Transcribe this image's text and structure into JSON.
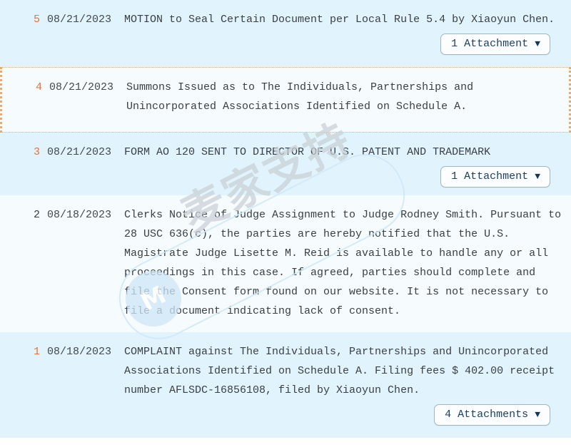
{
  "watermark": {
    "text": "麦家支持",
    "logo_glyph": "M"
  },
  "docket": {
    "entries": [
      {
        "number": "5",
        "number_color": "#e8713c",
        "date": "08/21/2023",
        "lines": [
          "MOTION to Seal Certain Document per Local Rule 5.4 by Xiaoyun Chen."
        ],
        "attachment_label": "1 Attachment",
        "caret": "▼"
      },
      {
        "number": "4",
        "number_color": "#e8713c",
        "date": "08/21/2023",
        "lines": [
          "Summons Issued as to The Individuals, Partnerships and",
          "Unincorporated Associations Identified on Schedule A."
        ],
        "attachment_label": "",
        "caret": ""
      },
      {
        "number": "3",
        "number_color": "#e8713c",
        "date": "08/21/2023",
        "lines": [
          "FORM AO 120 SENT TO DIRECTOR OF U.S. PATENT AND TRADEMARK"
        ],
        "attachment_label": "1 Attachment",
        "caret": "▼"
      },
      {
        "number": "2",
        "number_color": "#3b3b3b",
        "date": "08/18/2023",
        "lines": [
          "Clerks Notice of Judge Assignment to Judge Rodney Smith. Pursuant to",
          "28 USC 636(c), the parties are hereby notified that the U.S.",
          "Magistrate Judge Lisette M. Reid is available to handle any or all",
          "proceedings in this case. If agreed, parties should complete and",
          "file the Consent form found on our website. It is not necessary to",
          "file a document indicating lack of consent."
        ],
        "attachment_label": "",
        "caret": ""
      },
      {
        "number": "1",
        "number_color": "#e8713c",
        "date": "08/18/2023",
        "lines": [
          "COMPLAINT against The Individuals, Partnerships and Unincorporated",
          "Associations Identified on Schedule A. Filing fees $ 402.00 receipt",
          "number AFLSDC-16856108, filed by Xiaoyun Chen."
        ],
        "attachment_label": "4 Attachments",
        "caret": "▼"
      }
    ]
  }
}
